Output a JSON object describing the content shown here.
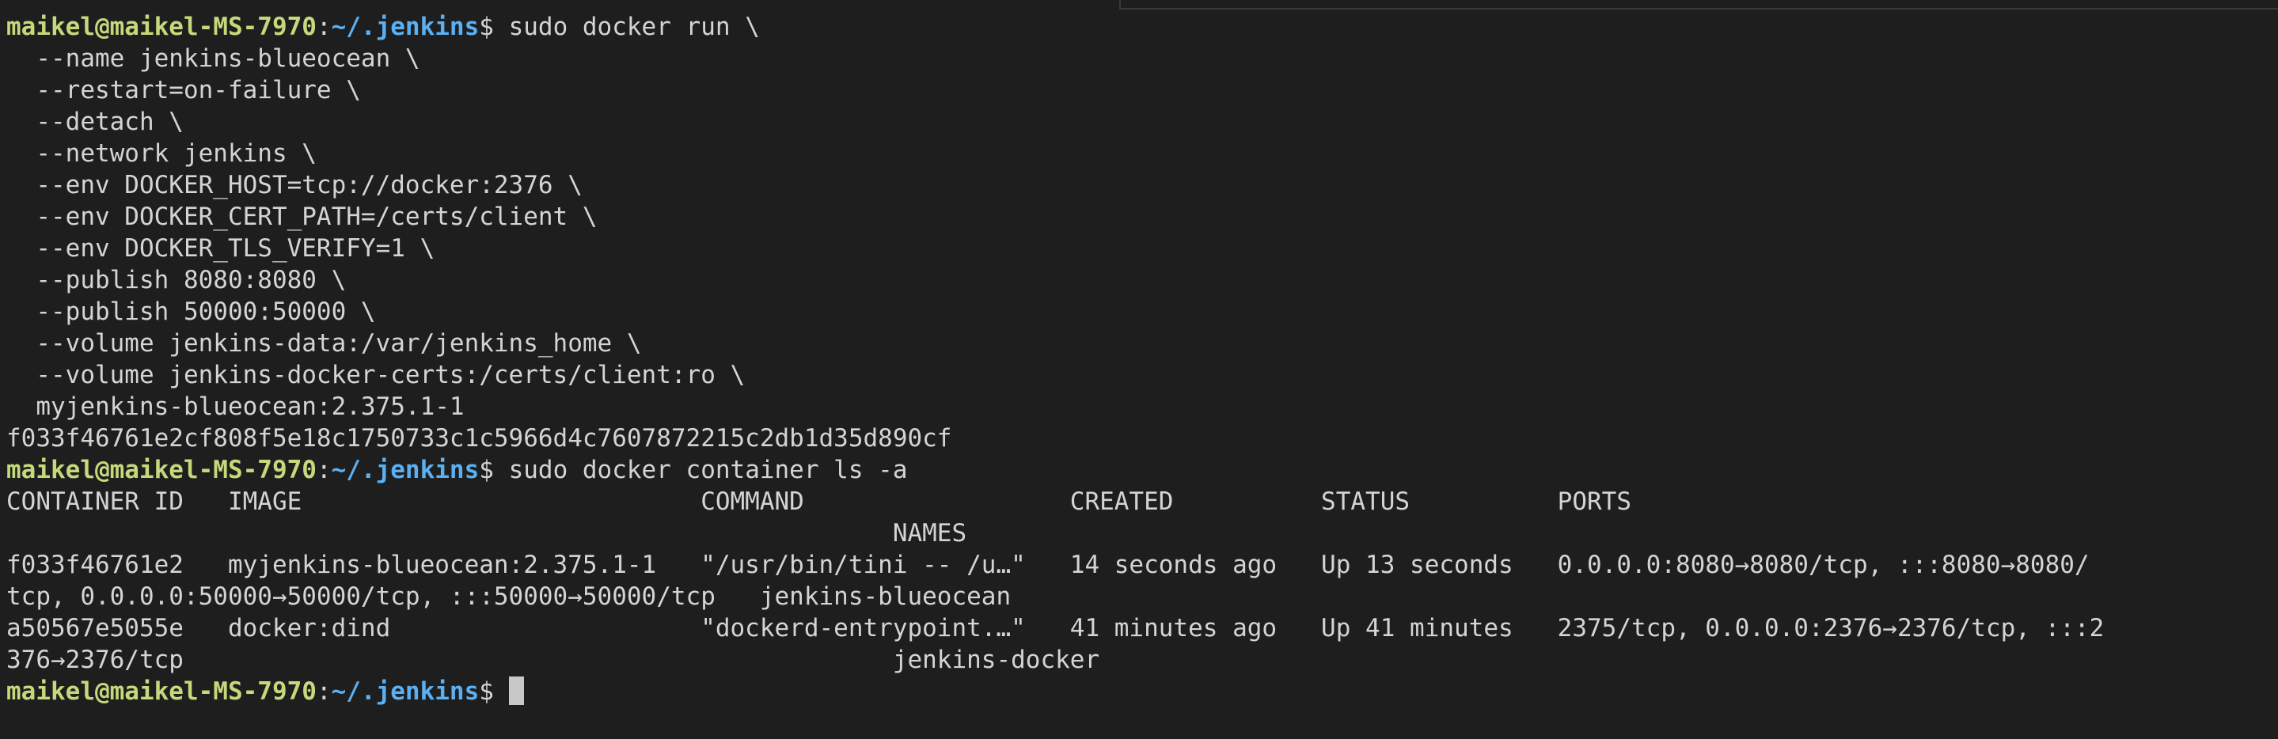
{
  "prompt": {
    "user": "maikel@maikel-MS-7970",
    "colon": ":",
    "path": "~/.jenkins",
    "dollar": "$ "
  },
  "colors": {
    "background": "#1e1e1e",
    "text": "#d4d4d4",
    "prompt_user": "#c4d97a",
    "prompt_path": "#5ab0f2"
  },
  "session": {
    "cmd1": "sudo docker run \\",
    "cmd1_args": [
      "  --name jenkins-blueocean \\",
      "  --restart=on-failure \\",
      "  --detach \\",
      "  --network jenkins \\",
      "  --env DOCKER_HOST=tcp://docker:2376 \\",
      "  --env DOCKER_CERT_PATH=/certs/client \\",
      "  --env DOCKER_TLS_VERIFY=1 \\",
      "  --publish 8080:8080 \\",
      "  --publish 50000:50000 \\",
      "  --volume jenkins-data:/var/jenkins_home \\",
      "  --volume jenkins-docker-certs:/certs/client:ro \\",
      "  myjenkins-blueocean:2.375.1-1"
    ],
    "container_hash": "f033f46761e2cf808f5e18c1750733c1c5966d4c7607872215c2db1d35d890cf",
    "cmd2": "sudo docker container ls -a",
    "ls_output": [
      "CONTAINER ID   IMAGE                           COMMAND                  CREATED          STATUS          PORTS",
      "                                                            NAMES",
      "f033f46761e2   myjenkins-blueocean:2.375.1-1   \"/usr/bin/tini -- /u…\"   14 seconds ago   Up 13 seconds   0.0.0.0:8080→8080/tcp, :::8080→8080/",
      "tcp, 0.0.0.0:50000→50000/tcp, :::50000→50000/tcp   jenkins-blueocean",
      "a50567e5055e   docker:dind                     \"dockerd-entrypoint.…\"   41 minutes ago   Up 41 minutes   2375/tcp, 0.0.0.0:2376→2376/tcp, :::2",
      "376→2376/tcp                                                jenkins-docker"
    ]
  }
}
